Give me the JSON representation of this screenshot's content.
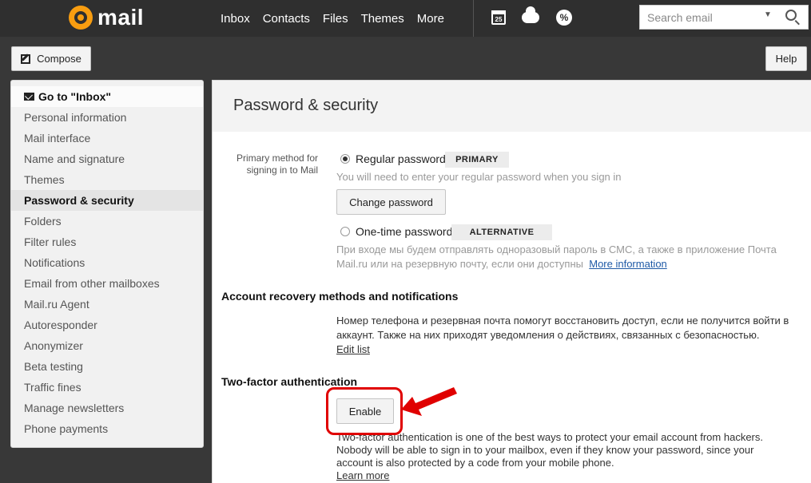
{
  "header": {
    "logo": "mail",
    "nav": [
      "Inbox",
      "Contacts",
      "Files",
      "Themes",
      "More"
    ],
    "calendar_day": "25",
    "search_placeholder": "Search email"
  },
  "toolbar": {
    "compose_label": "Compose",
    "help_label": "Help"
  },
  "sidebar": {
    "goto_label": "Go to \"Inbox\"",
    "items": [
      "Personal information",
      "Mail interface",
      "Name and signature",
      "Themes",
      "Password & security",
      "Folders",
      "Filter rules",
      "Notifications",
      "Email from other mailboxes",
      "Mail.ru Agent",
      "Autoresponder",
      "Anonymizer",
      "Beta testing",
      "Traffic fines",
      "Manage newsletters",
      "Phone payments"
    ],
    "active_item": "Password & security"
  },
  "main": {
    "title": "Password & security",
    "primary_method": {
      "label": "Primary method for signing in to Mail",
      "regular": {
        "label": "Regular password",
        "badge": "PRIMARY",
        "hint": "You will need to enter your regular password when you sign in",
        "button": "Change password",
        "selected": true
      },
      "onetime": {
        "label": "One-time password",
        "badge": "ALTERNATIVE",
        "hint_line1": "При входе мы будем отправлять одноразовый пароль в СМС, а также в приложение Почта",
        "hint_line2": "Mail.ru или на резервную почту, если они доступны",
        "link": "More information",
        "selected": false
      }
    },
    "recovery": {
      "title": "Account recovery methods and notifications",
      "text_line1": "Номер телефона и резервная почта помогут восстановить доступ, если не получится войти в",
      "text_line2": "аккаунт. Также на них приходят уведомления о действиях, связанных с безопасностью.",
      "link": "Edit list"
    },
    "two_factor": {
      "title": "Two-factor authentication",
      "button": "Enable",
      "text_line1": "Two-factor authentication is one of the best ways to protect your email account from hackers.",
      "text_line2": "Nobody will be able to sign in to your mailbox, even if they know your password, since your",
      "text_line3": "account is also protected by a code from your mobile phone.",
      "link": "Learn more"
    }
  },
  "colors": {
    "topbar": "#2f2f2f",
    "logo_accent": "#f89d10",
    "link": "#1f5aa6",
    "annotation": "#e00000"
  }
}
